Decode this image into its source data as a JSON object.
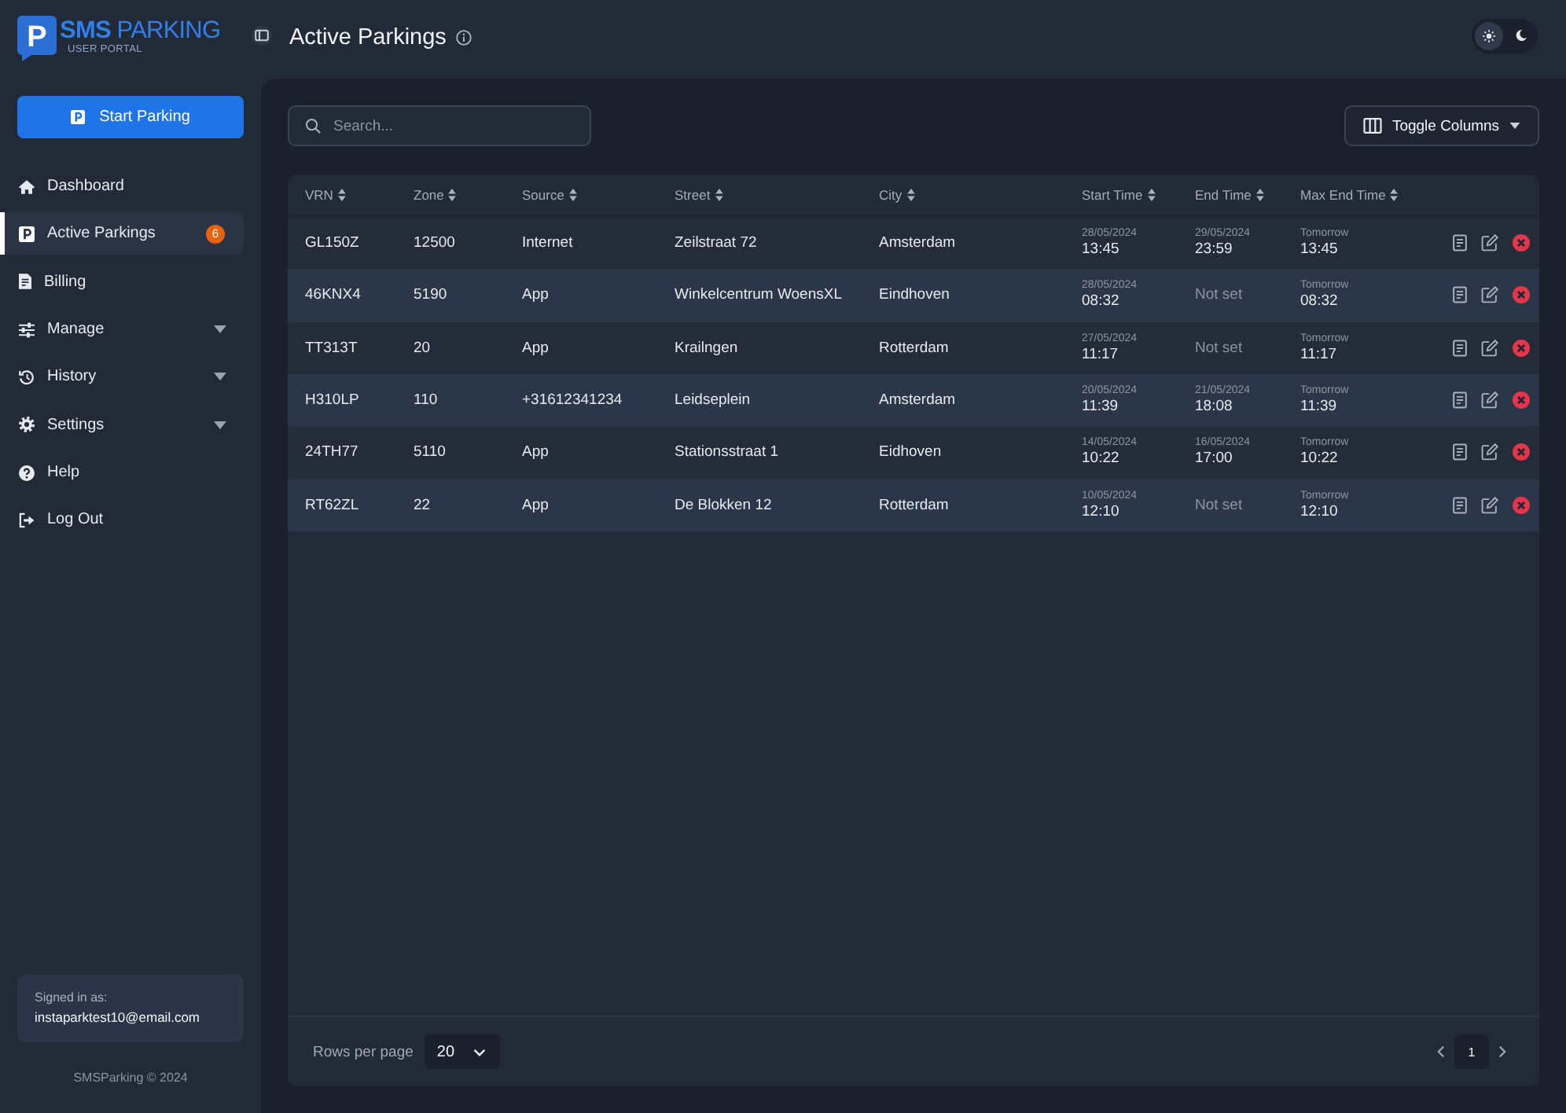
{
  "logo": {
    "mark": "P",
    "name": "**SMS** PARKING",
    "subtitle": "USER PORTAL"
  },
  "sidebar": {
    "start_button": "Start Parking",
    "nav": [
      {
        "label": "Dashboard",
        "selected": false,
        "expandable": false
      },
      {
        "label": "Active Parkings",
        "selected": true,
        "expandable": false,
        "badge": "6"
      },
      {
        "label": "Billing",
        "selected": false,
        "expandable": false
      },
      {
        "label": "Manage",
        "selected": false,
        "expandable": true
      },
      {
        "label": "History",
        "selected": false,
        "expandable": true
      },
      {
        "label": "Settings",
        "selected": false,
        "expandable": true
      },
      {
        "label": "Help",
        "selected": false,
        "expandable": false
      },
      {
        "label": "Log Out",
        "selected": false,
        "expandable": false
      }
    ],
    "account": {
      "label": "Signed in as:",
      "email": "instaparktest10@email.com"
    },
    "footer": "SMSParking © 2024"
  },
  "header": {
    "title": "Active Parkings",
    "theme_options": [
      {
        "selected": true
      },
      {
        "selected": false
      }
    ]
  },
  "toolbar": {
    "search": {
      "placeholder": "Search..."
    },
    "toggle_columns": "Toggle Columns"
  },
  "table": {
    "columns": [
      "VRN",
      "Zone",
      "Source",
      "Street",
      "City",
      "Start Time",
      "End Time",
      "Max End Time"
    ],
    "rows": [
      {
        "vrn": "GL150Z",
        "zone": "12500",
        "source": "Internet",
        "street": "Zeilstraat 72",
        "city": "Amsterdam",
        "start_time": {
          "kind": "datetime",
          "date": "28/05/2024",
          "time": "13:45"
        },
        "end_time": {
          "kind": "datetime",
          "date": "29/05/2024",
          "time": "23:59"
        },
        "max_end_time": {
          "kind": "datetime",
          "date": "Tomorrow",
          "time": "13:45"
        }
      },
      {
        "vrn": "46KNX4",
        "zone": "5190",
        "source": "App",
        "street": "Winkelcentrum WoensXL",
        "city": "Eindhoven",
        "start_time": {
          "kind": "datetime",
          "date": "28/05/2024",
          "time": "08:32"
        },
        "end_time": {
          "kind": "unset",
          "text": "Not set"
        },
        "max_end_time": {
          "kind": "datetime",
          "date": "Tomorrow",
          "time": "08:32"
        }
      },
      {
        "vrn": "TT313T",
        "zone": "20",
        "source": "App",
        "street": "Krailngen",
        "city": "Rotterdam",
        "start_time": {
          "kind": "datetime",
          "date": "27/05/2024",
          "time": "11:17"
        },
        "end_time": {
          "kind": "unset",
          "text": "Not set"
        },
        "max_end_time": {
          "kind": "datetime",
          "date": "Tomorrow",
          "time": "11:17"
        }
      },
      {
        "vrn": "H310LP",
        "zone": "110",
        "source": "+31612341234",
        "street": "Leidseplein",
        "city": "Amsterdam",
        "start_time": {
          "kind": "datetime",
          "date": "20/05/2024",
          "time": "11:39"
        },
        "end_time": {
          "kind": "datetime",
          "date": "21/05/2024",
          "time": "18:08"
        },
        "max_end_time": {
          "kind": "datetime",
          "date": "Tomorrow",
          "time": "11:39"
        }
      },
      {
        "vrn": "24TH77",
        "zone": "5110",
        "source": "App",
        "street": "Stationsstraat 1",
        "city": "Eidhoven",
        "start_time": {
          "kind": "datetime",
          "date": "14/05/2024",
          "time": "10:22"
        },
        "end_time": {
          "kind": "datetime",
          "date": "16/05/2024",
          "time": "17:00"
        },
        "max_end_time": {
          "kind": "datetime",
          "date": "Tomorrow",
          "time": "10:22"
        }
      },
      {
        "vrn": "RT62ZL",
        "zone": "22",
        "source": "App",
        "street": "De Blokken 12",
        "city": "Rotterdam",
        "start_time": {
          "kind": "datetime",
          "date": "10/05/2024",
          "time": "12:10"
        },
        "end_time": {
          "kind": "unset",
          "text": "Not set"
        },
        "max_end_time": {
          "kind": "datetime",
          "date": "Tomorrow",
          "time": "12:10"
        }
      }
    ]
  },
  "pagination": {
    "rows_per_page_label": "Rows per page",
    "rows_per_page": "20",
    "pages": [
      {
        "label": "1",
        "selected": true
      }
    ]
  }
}
